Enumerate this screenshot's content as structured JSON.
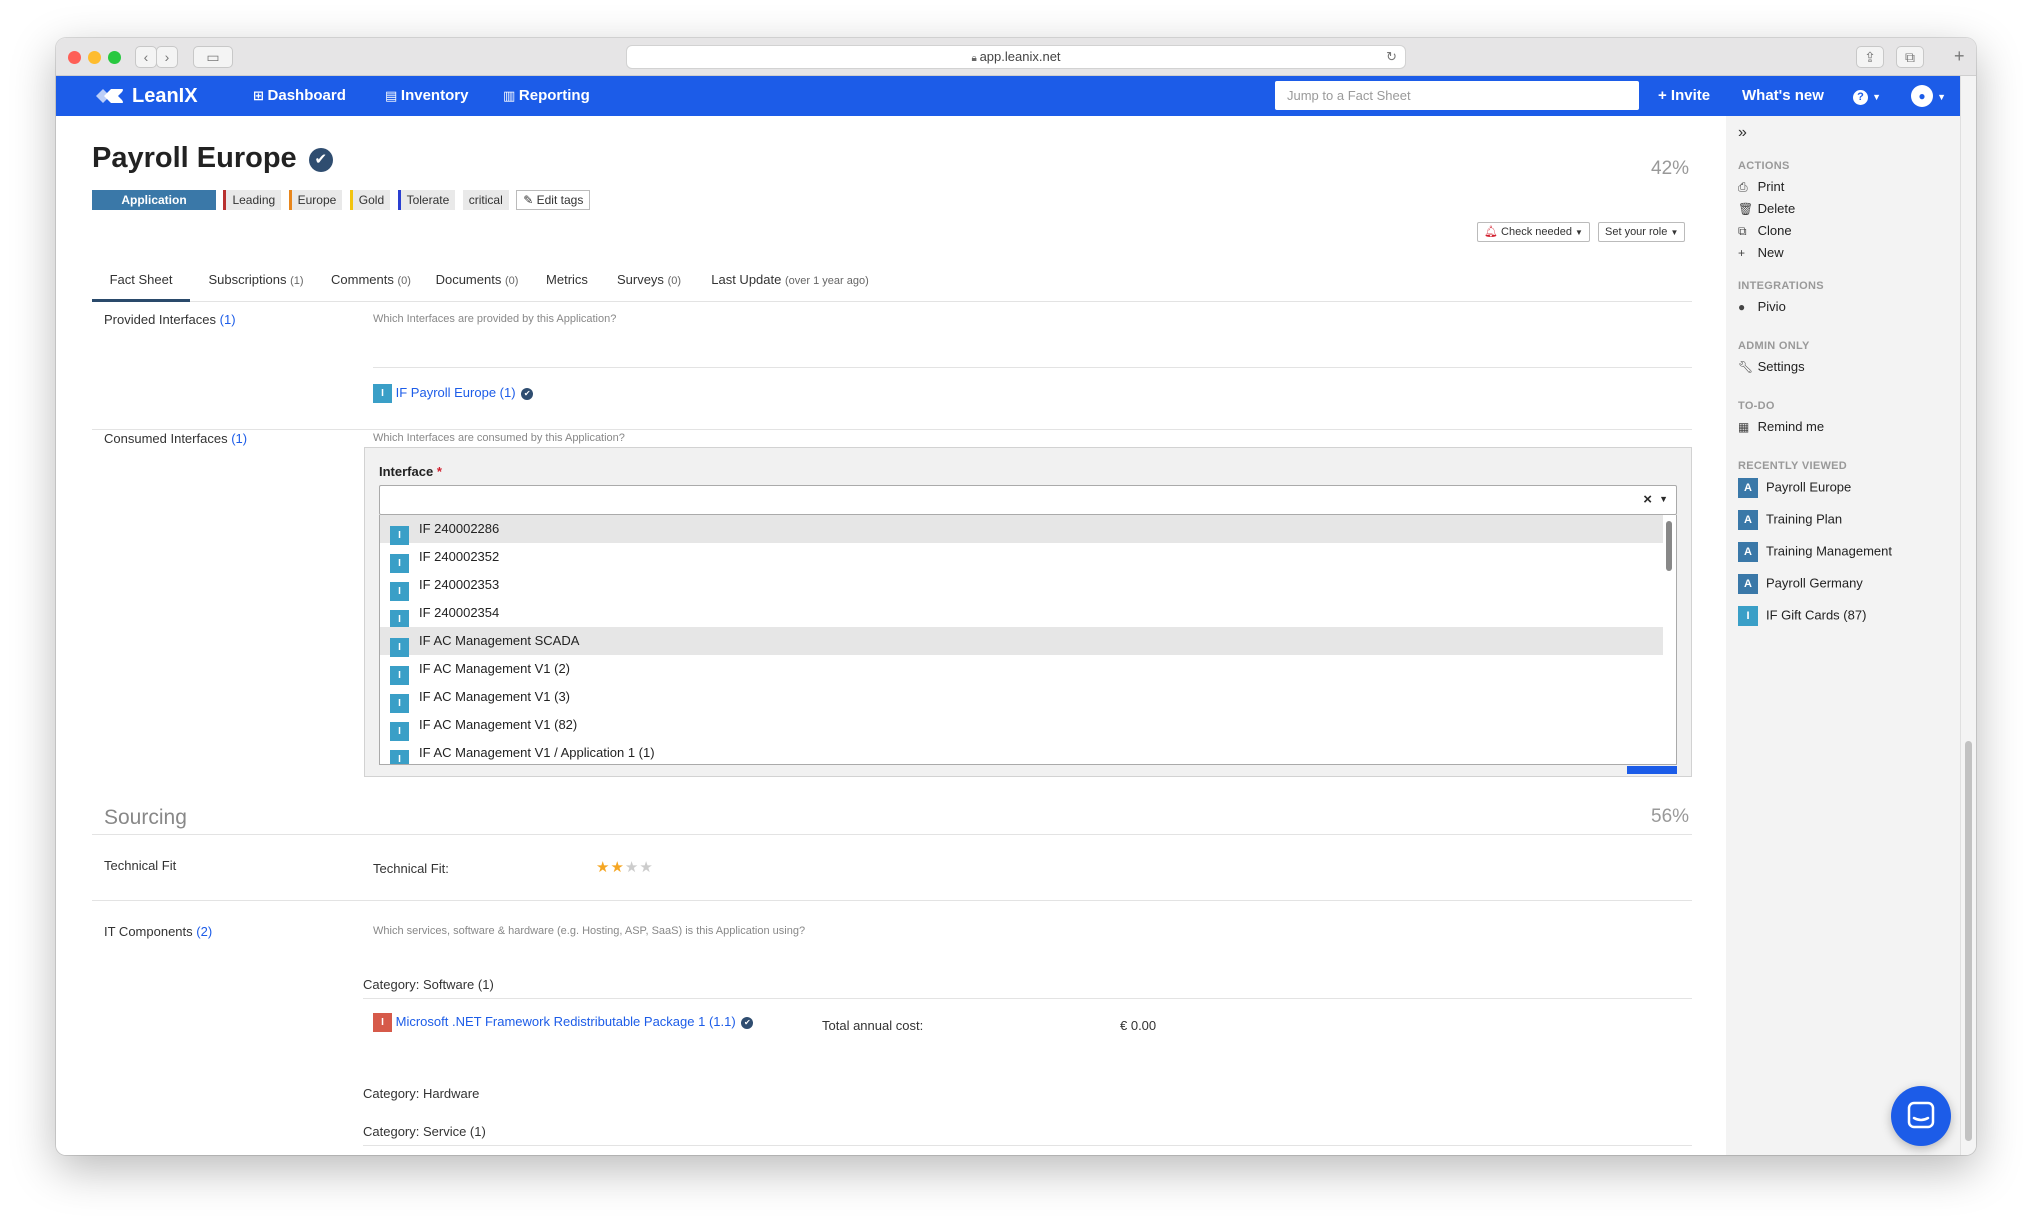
{
  "browser": {
    "url": "app.leanix.net"
  },
  "nav": {
    "brand": "LeanIX",
    "dashboard": "Dashboard",
    "inventory": "Inventory",
    "reporting": "Reporting",
    "search_placeholder": "Jump to a Fact Sheet",
    "invite": "+ Invite",
    "whats_new": "What's new",
    "help": "?"
  },
  "header": {
    "title": "Payroll Europe",
    "completion": "42%",
    "type_tag": "Application",
    "tags": [
      {
        "label": "Leading",
        "color": "#b8312f"
      },
      {
        "label": "Europe",
        "color": "#e8861c"
      },
      {
        "label": "Gold",
        "color": "#f2c40f"
      },
      {
        "label": "Tolerate",
        "color": "#2a3fd1"
      },
      {
        "label": "critical",
        "color": ""
      }
    ],
    "edit_tags": "Edit tags",
    "check_needed": "Check needed",
    "set_role": "Set your role"
  },
  "tabs": [
    {
      "label": "Fact Sheet",
      "extra": ""
    },
    {
      "label": "Subscriptions",
      "extra": "(1)"
    },
    {
      "label": "Comments",
      "extra": "(0)"
    },
    {
      "label": "Documents",
      "extra": "(0)"
    },
    {
      "label": "Metrics",
      "extra": ""
    },
    {
      "label": "Surveys",
      "extra": "(0)"
    },
    {
      "label": "Last Update",
      "extra": "(over 1 year ago)"
    }
  ],
  "provided": {
    "label": "Provided Interfaces",
    "count": "(1)",
    "hint": "Which Interfaces are provided by this Application?",
    "item": "IF Payroll Europe (1)"
  },
  "consumed": {
    "label": "Consumed Interfaces",
    "count": "(1)",
    "hint": "Which Interfaces are consumed by this Application?",
    "field_label": "Interface",
    "required": "*",
    "clear": "×",
    "options": [
      "IF 240002286",
      "IF 240002352",
      "IF 240002353",
      "IF 240002354",
      "IF AC Management SCADA",
      "IF AC Management V1 (2)",
      "IF AC Management V1 (3)",
      "IF AC Management V1 (82)",
      "IF AC Management V1 / Application 1 (1)"
    ]
  },
  "sourcing": {
    "title": "Sourcing",
    "completion": "56%",
    "technical_fit_label": "Technical Fit",
    "technical_fit_field": "Technical Fit:",
    "technical_fit_value": 2,
    "technical_fit_max": 4,
    "it_components_label": "IT Components",
    "it_components_count": "(2)",
    "it_components_hint": "Which services, software & hardware (e.g. Hosting, ASP, SaaS) is this Application using?",
    "cat_software": "Category: Software (1)",
    "software_item": "Microsoft .NET Framework Redistributable Package 1 (1.1)",
    "cost_label": "Total annual cost:",
    "cost_value": "€ 0.00",
    "cat_hardware": "Category: Hardware",
    "cat_service": "Category: Service (1)"
  },
  "sidebar": {
    "actions_title": "ACTIONS",
    "actions": [
      "Print",
      "Delete",
      "Clone",
      "New"
    ],
    "integrations_title": "INTEGRATIONS",
    "integration": "Pivio",
    "admin_title": "ADMIN ONLY",
    "settings": "Settings",
    "todo_title": "TO-DO",
    "remind": "Remind me",
    "recent_title": "RECENTLY VIEWED",
    "recent": [
      {
        "badge": "A",
        "label": "Payroll Europe"
      },
      {
        "badge": "A",
        "label": "Training Plan"
      },
      {
        "badge": "A",
        "label": "Training Management"
      },
      {
        "badge": "A",
        "label": "Payroll Germany"
      },
      {
        "badge": "I",
        "label": "IF Gift Cards (87)"
      }
    ]
  },
  "colors": {
    "brand": "#1c5ce8",
    "app_tag": "#3a78a8",
    "interface_badge": "#3a9fc7",
    "it_badge": "#d65a4a",
    "star": "#f5a623"
  }
}
